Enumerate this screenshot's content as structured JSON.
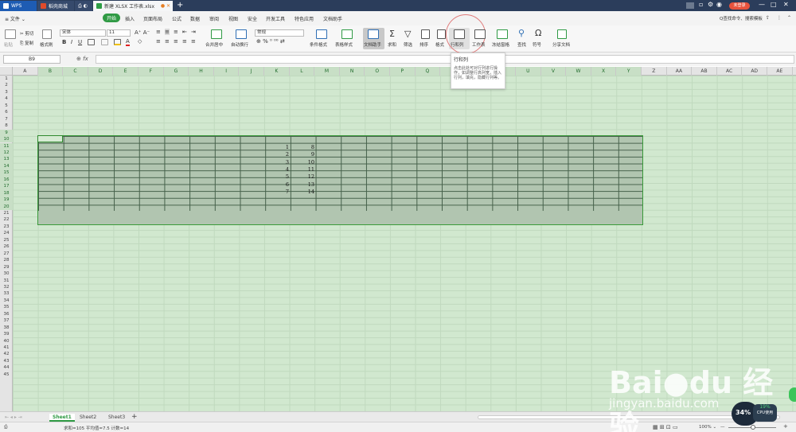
{
  "titlebar": {
    "tabs": [
      {
        "label": "WPS"
      },
      {
        "label": "稻壳商城"
      },
      {
        "label": ""
      },
      {
        "label": "新建 XLSX 工作表.xlsx"
      }
    ],
    "new_tab": "+",
    "login": "未登录",
    "win_controls": [
      "—",
      "□",
      "✕"
    ]
  },
  "menu": {
    "file": "≡ 文件 ⌄",
    "items": [
      "开始",
      "插入",
      "页面布局",
      "公式",
      "数据",
      "审阅",
      "视图",
      "安全",
      "开发工具",
      "特色应用",
      "文档助手"
    ],
    "search": "Q查找命令、搜索模板"
  },
  "toolbar": {
    "paste": "粘贴",
    "cut": "✂ 剪切",
    "copy": "⎘ 复制",
    "format_painter": "格式刷",
    "font_name": "宋体",
    "font_size": "11",
    "merge": "合并居中",
    "wrap": "自动换行",
    "number_format": "常规",
    "cond_format": "条件格式",
    "table_style": "表格样式",
    "doc_helper": "文档助手",
    "sum": "求和",
    "filter": "筛选",
    "sort": "排序",
    "format": "格式",
    "row_col": "行和列",
    "worksheet": "工作表",
    "freeze": "冻结窗格",
    "find": "查找",
    "symbol": "符号",
    "share": "分享文档"
  },
  "tooltip": {
    "title": "行和列",
    "body": "点击此处可对行列进行操作，如调整行高列宽，插入行列，填充，隐藏行列等。"
  },
  "formula": {
    "cell_ref": "B9",
    "fx": "fx",
    "value": ""
  },
  "columns": [
    "A",
    "B",
    "C",
    "D",
    "E",
    "F",
    "G",
    "H",
    "I",
    "J",
    "K",
    "L",
    "M",
    "N",
    "O",
    "P",
    "Q",
    "R",
    "S",
    "T",
    "U",
    "V",
    "W",
    "X",
    "Y",
    "Z",
    "AA",
    "AB",
    "AC",
    "AD",
    "AE"
  ],
  "rows": [
    "1",
    "2",
    "3",
    "4",
    "5",
    "6",
    "7",
    "8",
    "9",
    "10",
    "11",
    "12",
    "13",
    "14",
    "15",
    "16",
    "17",
    "18",
    "19",
    "20",
    "21",
    "22",
    "23",
    "24",
    "25",
    "26",
    "27",
    "28",
    "29",
    "30",
    "31",
    "32",
    "33",
    "34",
    "35",
    "36",
    "37",
    "38",
    "39",
    "40",
    "41",
    "42",
    "43",
    "44",
    "45"
  ],
  "data": {
    "col_k": [
      "1",
      "2",
      "3",
      "4",
      "5",
      "6",
      "7"
    ],
    "col_l": [
      "8",
      "9",
      "10",
      "11",
      "12",
      "13",
      "14"
    ]
  },
  "sheets": [
    "Sheet1",
    "Sheet2",
    "Sheet3"
  ],
  "add_sheet": "+",
  "status": {
    "summary": "求和=105  平均值=7.5  计数=14",
    "zoom": "100% ⌄"
  },
  "watermark": {
    "brand": "Bai●du 经验",
    "url": "jingyan.baidu.com"
  },
  "widgets": {
    "percent": "34%",
    "cpu_value": "19%",
    "cpu_label": "CPU使用"
  },
  "colors": {
    "accent": "#2f9a44",
    "title_bg": "#2b3d5b",
    "sheet_bg": "#d1e8cf",
    "table_bg": "#b1c5b0"
  }
}
